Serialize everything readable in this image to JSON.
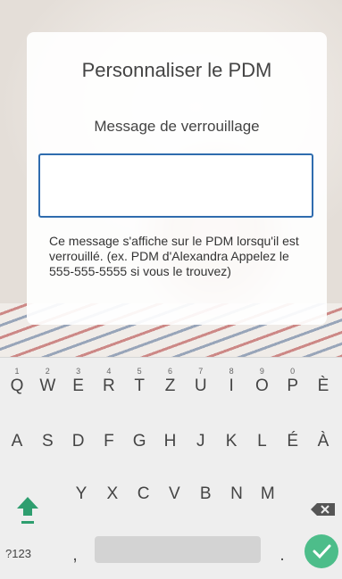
{
  "card": {
    "title": "Personnaliser le PDM",
    "field_label": "Message de verrouillage",
    "input_value": "",
    "help_text": "Ce message s'affiche sur le PDM lorsqu'il est verrouillé. (ex. PDM d'Alexandra Appelez le 555-555-5555 si vous le trouvez)"
  },
  "keyboard": {
    "row1": [
      {
        "key": "Q",
        "hint": "1"
      },
      {
        "key": "W",
        "hint": "2"
      },
      {
        "key": "E",
        "hint": "3"
      },
      {
        "key": "R",
        "hint": "4"
      },
      {
        "key": "T",
        "hint": "5"
      },
      {
        "key": "Z",
        "hint": "6"
      },
      {
        "key": "U",
        "hint": "7"
      },
      {
        "key": "I",
        "hint": "8"
      },
      {
        "key": "O",
        "hint": "9"
      },
      {
        "key": "P",
        "hint": "0"
      },
      {
        "key": "È",
        "hint": ""
      }
    ],
    "row2": [
      "A",
      "S",
      "D",
      "F",
      "G",
      "H",
      "J",
      "K",
      "L",
      "É",
      "À"
    ],
    "row3": [
      "Y",
      "X",
      "C",
      "V",
      "B",
      "N",
      "M"
    ],
    "symbols_label": "?123",
    "comma_label": ",",
    "period_label": ".",
    "accent_color": "#4dbd8a",
    "shift_color": "#2e9e6f"
  }
}
